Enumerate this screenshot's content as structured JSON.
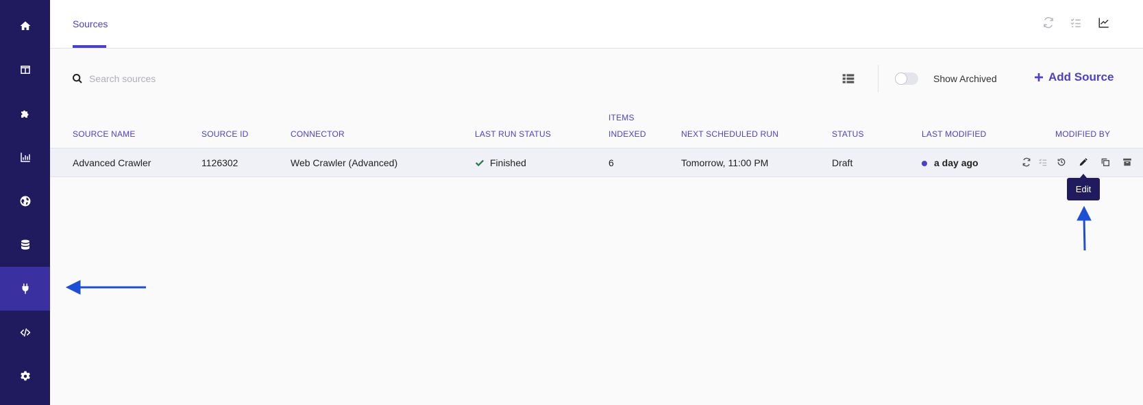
{
  "sidebar": {
    "items": [
      {
        "icon": "home-icon"
      },
      {
        "icon": "layout-icon"
      },
      {
        "icon": "puzzle-icon"
      },
      {
        "icon": "bar-chart-icon"
      },
      {
        "icon": "globe-icon"
      },
      {
        "icon": "database-icon"
      },
      {
        "icon": "plug-icon",
        "active": true
      },
      {
        "icon": "code-icon"
      },
      {
        "icon": "gear-icon"
      }
    ]
  },
  "header": {
    "tab_label": "Sources",
    "icons": [
      "refresh-icon",
      "checklist-icon",
      "trend-chart-icon"
    ]
  },
  "toolbar": {
    "search_placeholder": "Search sources",
    "show_archived_label": "Show Archived",
    "show_archived_on": false,
    "add_source_label": "Add Source"
  },
  "table": {
    "headers": {
      "source_name": "SOURCE NAME",
      "source_id": "SOURCE ID",
      "connector": "CONNECTOR",
      "last_run_status": "LAST RUN STATUS",
      "items_indexed_1": "ITEMS",
      "items_indexed_2": "INDEXED",
      "next_scheduled_run": "NEXT SCHEDULED RUN",
      "status": "STATUS",
      "last_modified": "LAST MODIFIED",
      "modified_by": "MODIFIED BY"
    },
    "rows": [
      {
        "source_name": "Advanced Crawler",
        "source_id": "1126302",
        "connector": "Web Crawler (Advanced)",
        "last_run_status": "Finished",
        "items_indexed": "6",
        "next_scheduled_run": "Tomorrow, 11:00 PM",
        "status": "Draft",
        "last_modified": "a day ago"
      }
    ],
    "row_actions": [
      "refresh-icon",
      "checklist-icon",
      "history-icon",
      "pencil-icon",
      "copy-icon",
      "archive-icon"
    ]
  },
  "tooltip": {
    "text": "Edit"
  },
  "colors": {
    "sidebar": "#1f1b5e",
    "sidebar_active": "#3a30a0",
    "accent": "#4b3fd0",
    "success": "#2e7d4f",
    "annotation_arrow": "#1d4ed8"
  }
}
